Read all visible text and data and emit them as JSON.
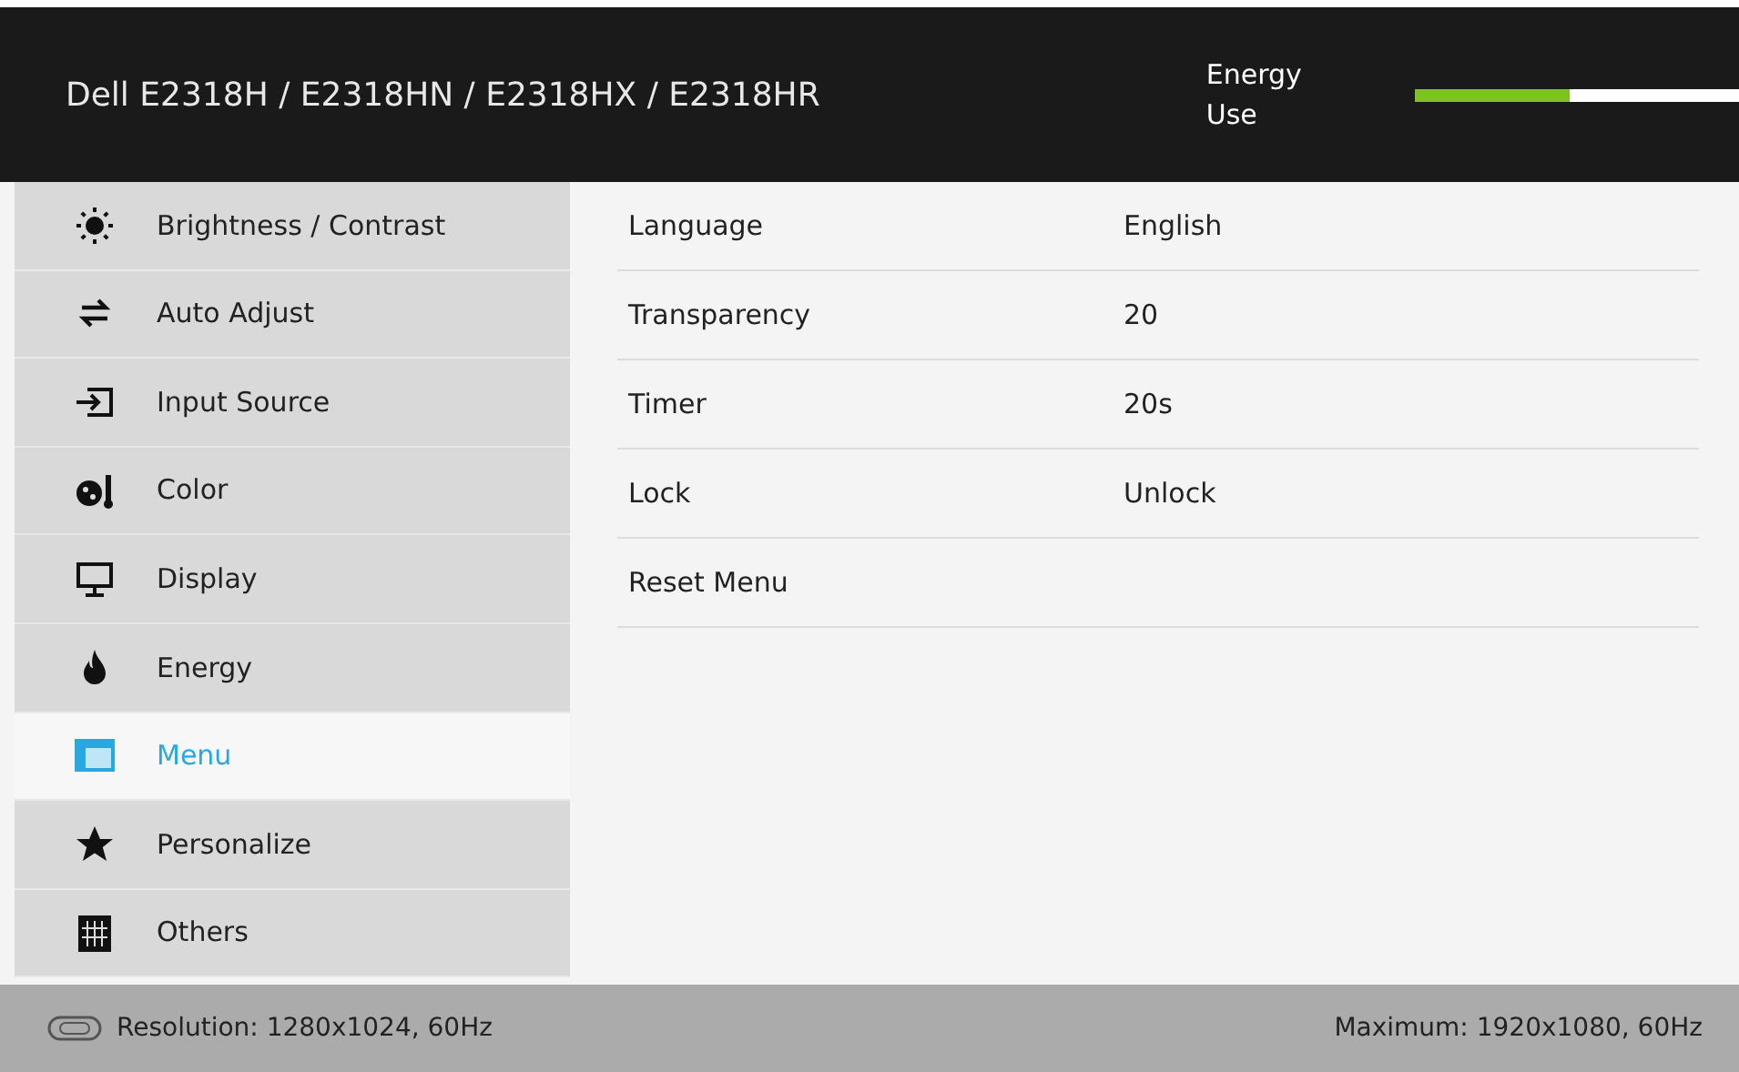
{
  "header": {
    "title": "Dell E2318H / E2318HN / E2318HX / E2318HR",
    "energy_label": "Energy Use",
    "energy": {
      "level": 0.48
    }
  },
  "sidebar": {
    "items": [
      {
        "label": "Brightness / Contrast",
        "kind": "brightness",
        "selected": false
      },
      {
        "label": "Auto Adjust",
        "kind": "auto",
        "selected": false
      },
      {
        "label": "Input Source",
        "kind": "input",
        "selected": false
      },
      {
        "label": "Color",
        "kind": "color",
        "selected": false
      },
      {
        "label": "Display",
        "kind": "display",
        "selected": false
      },
      {
        "label": "Energy",
        "kind": "energy",
        "selected": false
      },
      {
        "label": "Menu",
        "kind": "menu",
        "selected": true
      },
      {
        "label": "Personalize",
        "kind": "star",
        "selected": false
      },
      {
        "label": "Others",
        "kind": "others",
        "selected": false
      }
    ]
  },
  "settings": [
    {
      "name": "Language",
      "value": "English"
    },
    {
      "name": "Transparency",
      "value": "20"
    },
    {
      "name": "Timer",
      "value": "20s"
    },
    {
      "name": "Lock",
      "value": "Unlock"
    },
    {
      "name": "Reset Menu"
    }
  ],
  "status_bar": {
    "resolution": "Resolution: 1280x1024, 60Hz",
    "maximum": "Maximum: 1920x1080, 60Hz"
  }
}
